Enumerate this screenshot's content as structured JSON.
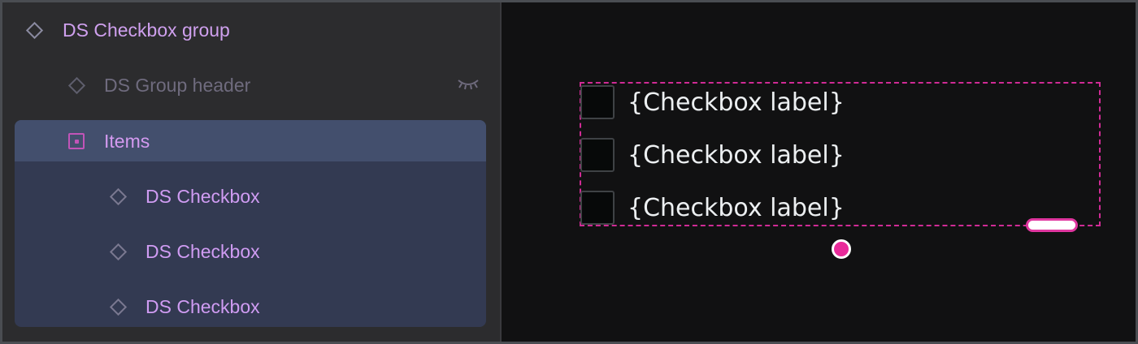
{
  "layers": {
    "group": {
      "label": "DS Checkbox group",
      "icon": "component-diamond-icon"
    },
    "header": {
      "label": "DS Group header",
      "icon": "component-diamond-icon",
      "visibility_icon": "eye-closed-icon"
    },
    "items": {
      "label": "Items",
      "icon": "frame-icon"
    },
    "children": [
      {
        "label": "DS Checkbox",
        "icon": "component-diamond-icon"
      },
      {
        "label": "DS Checkbox",
        "icon": "component-diamond-icon"
      },
      {
        "label": "DS Checkbox",
        "icon": "component-diamond-icon"
      }
    ]
  },
  "canvas": {
    "checkboxes": [
      {
        "label": "{Checkbox label}"
      },
      {
        "label": "{Checkbox label}"
      },
      {
        "label": "{Checkbox label}"
      }
    ],
    "selection_color": "#d02b95"
  }
}
